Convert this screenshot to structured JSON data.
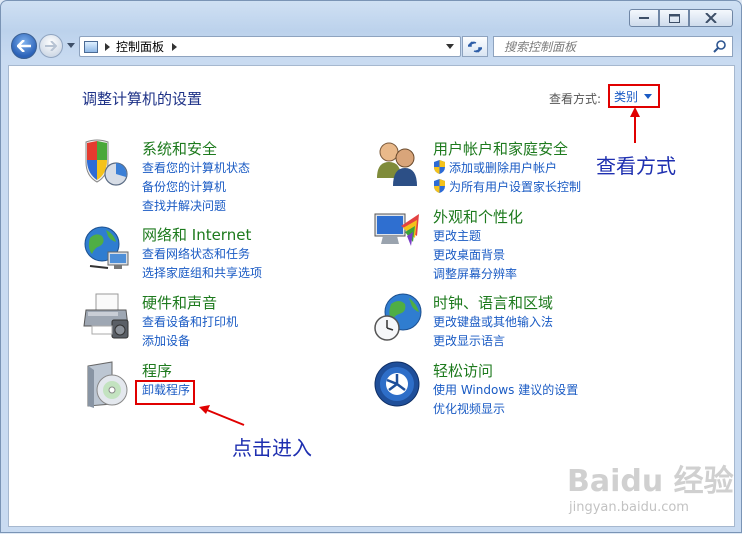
{
  "window": {
    "caption_buttons": [
      "minimize",
      "maximize",
      "close"
    ]
  },
  "nav": {
    "address_crumb": "控制面板",
    "search_placeholder": "搜索控制面板"
  },
  "main": {
    "title": "调整计算机的设置",
    "view_label": "查看方式:",
    "view_value": "类别",
    "categories": [
      {
        "heading": "系统和安全",
        "icon": "system-security-icon",
        "links": [
          "查看您的计算机状态",
          "备份您的计算机",
          "查找并解决问题"
        ]
      },
      {
        "heading": "网络和 Internet",
        "icon": "network-globe-icon",
        "links": [
          "查看网络状态和任务",
          "选择家庭组和共享选项"
        ]
      },
      {
        "heading": "硬件和声音",
        "icon": "printer-hardware-icon",
        "links": [
          "查看设备和打印机",
          "添加设备"
        ]
      },
      {
        "heading": "程序",
        "icon": "programs-disc-icon",
        "links": [
          "卸载程序"
        ]
      },
      {
        "heading": "用户帐户和家庭安全",
        "icon": "user-accounts-icon",
        "links": [
          "添加或删除用户帐户",
          "为所有用户设置家长控制"
        ]
      },
      {
        "heading": "外观和个性化",
        "icon": "appearance-palette-icon",
        "links": [
          "更改主题",
          "更改桌面背景",
          "调整屏幕分辨率"
        ]
      },
      {
        "heading": "时钟、语言和区域",
        "icon": "clock-globe-icon",
        "links": [
          "更改键盘或其他输入法",
          "更改显示语言"
        ]
      },
      {
        "heading": "轻松访问",
        "icon": "ease-of-access-icon",
        "links": [
          "使用 Windows 建议的设置",
          "优化视频显示"
        ]
      }
    ]
  },
  "annotations": {
    "view_mode_note": "查看方式",
    "click_enter_note": "点击进入",
    "highlight_color": "#e00000",
    "note_color": "#1e2fb0"
  },
  "watermark": {
    "brand": "Baidu 经验",
    "url": "jingyan.baidu.com"
  }
}
